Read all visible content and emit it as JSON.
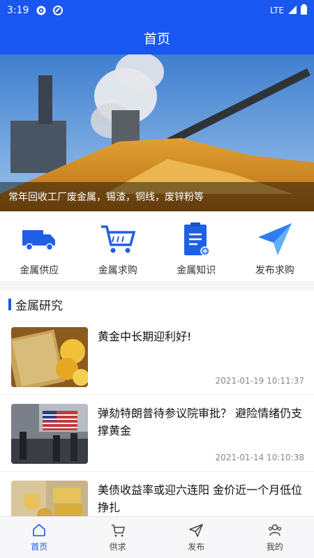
{
  "status": {
    "time": "3:19",
    "network": "LTE"
  },
  "header": {
    "title": "首页"
  },
  "banner": {
    "caption": "常年回收工厂废金属，锡渣，铜线，废锌粉等"
  },
  "quick_links": [
    {
      "label": "金属供应",
      "icon": "truck-icon"
    },
    {
      "label": "金属求购",
      "icon": "cart-icon"
    },
    {
      "label": "金属知识",
      "icon": "clipboard-icon"
    },
    {
      "label": "发布求购",
      "icon": "paper-plane-icon"
    }
  ],
  "research": {
    "title": "金属研究",
    "articles": [
      {
        "title": "黄金中长期迎利好!",
        "date": "2021-01-19 10:11:37"
      },
      {
        "title": "弹劾特朗普待参议院审批？ 避险情绪仍支撑黄金",
        "date": "2021-01-14 10:10:38"
      },
      {
        "title": "美债收益率或迎六连阳 金价近一个月低位挣扎",
        "date": ""
      }
    ]
  },
  "tabs": [
    {
      "label": "首页",
      "active": true
    },
    {
      "label": "供求",
      "active": false
    },
    {
      "label": "发布",
      "active": false
    },
    {
      "label": "我的",
      "active": false
    }
  ],
  "colors": {
    "primary": "#1a56f0",
    "icon_blue": "#1f5fe6"
  }
}
